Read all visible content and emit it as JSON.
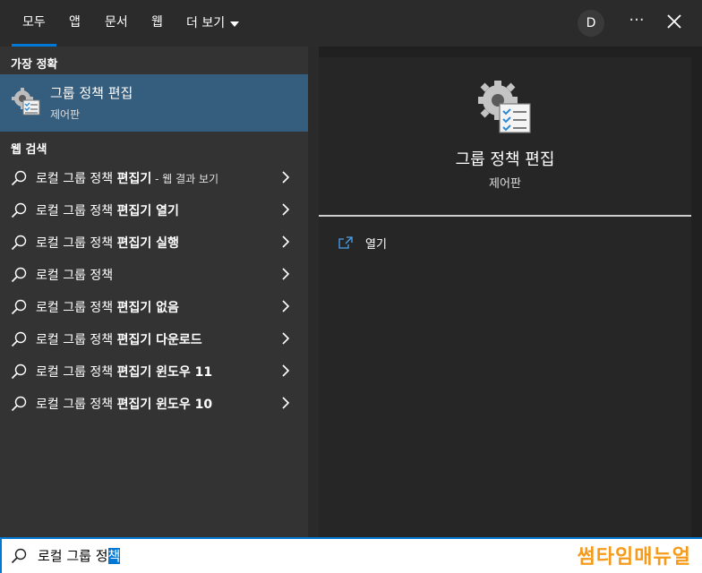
{
  "tabs": [
    {
      "label": "모두",
      "active": true
    },
    {
      "label": "앱"
    },
    {
      "label": "문서"
    },
    {
      "label": "웹"
    },
    {
      "label": "더 보기"
    }
  ],
  "account": {
    "initial": "D"
  },
  "more_options": "···",
  "left": {
    "best_match_title": "가장 정확",
    "best_match": {
      "title": "그룹 정책 편집",
      "subtitle": "제어판",
      "icon": "group-policy-icon"
    },
    "web_title": "웹 검색",
    "web_suffix": " - 웹 결과 보기",
    "results": [
      {
        "normal": "로컬 그룹 정책 ",
        "bold": "편집기"
      },
      {
        "normal": "로컬 그룹 정책 ",
        "bold": "편집기 열기"
      },
      {
        "normal": "로컬 그룹 정책 ",
        "bold": "편집기 실행"
      },
      {
        "normal": "로컬 그룹 정책",
        "bold": ""
      },
      {
        "normal": "로컬 그룹 정책 ",
        "bold": "편집기 없음"
      },
      {
        "normal": "로컬 그룹 정책 ",
        "bold": "편집기 다운로드"
      },
      {
        "normal": "로컬 그룹 정책 ",
        "bold": "편집기 윈도우 11"
      },
      {
        "normal": "로컬 그룹 정책 ",
        "bold": "편집기 윈도우 10"
      }
    ]
  },
  "preview": {
    "title": "그룹 정책 편집",
    "subtitle": "제어판",
    "action_open": "열기"
  },
  "search": {
    "query_normal": "로컬 그룹 정",
    "query_selected": "책"
  },
  "watermark": "썸타임매뉴얼",
  "colors": {
    "accent": "#0078d4",
    "selected_bg": "#355d7d",
    "watermark": "#f59a1a"
  }
}
